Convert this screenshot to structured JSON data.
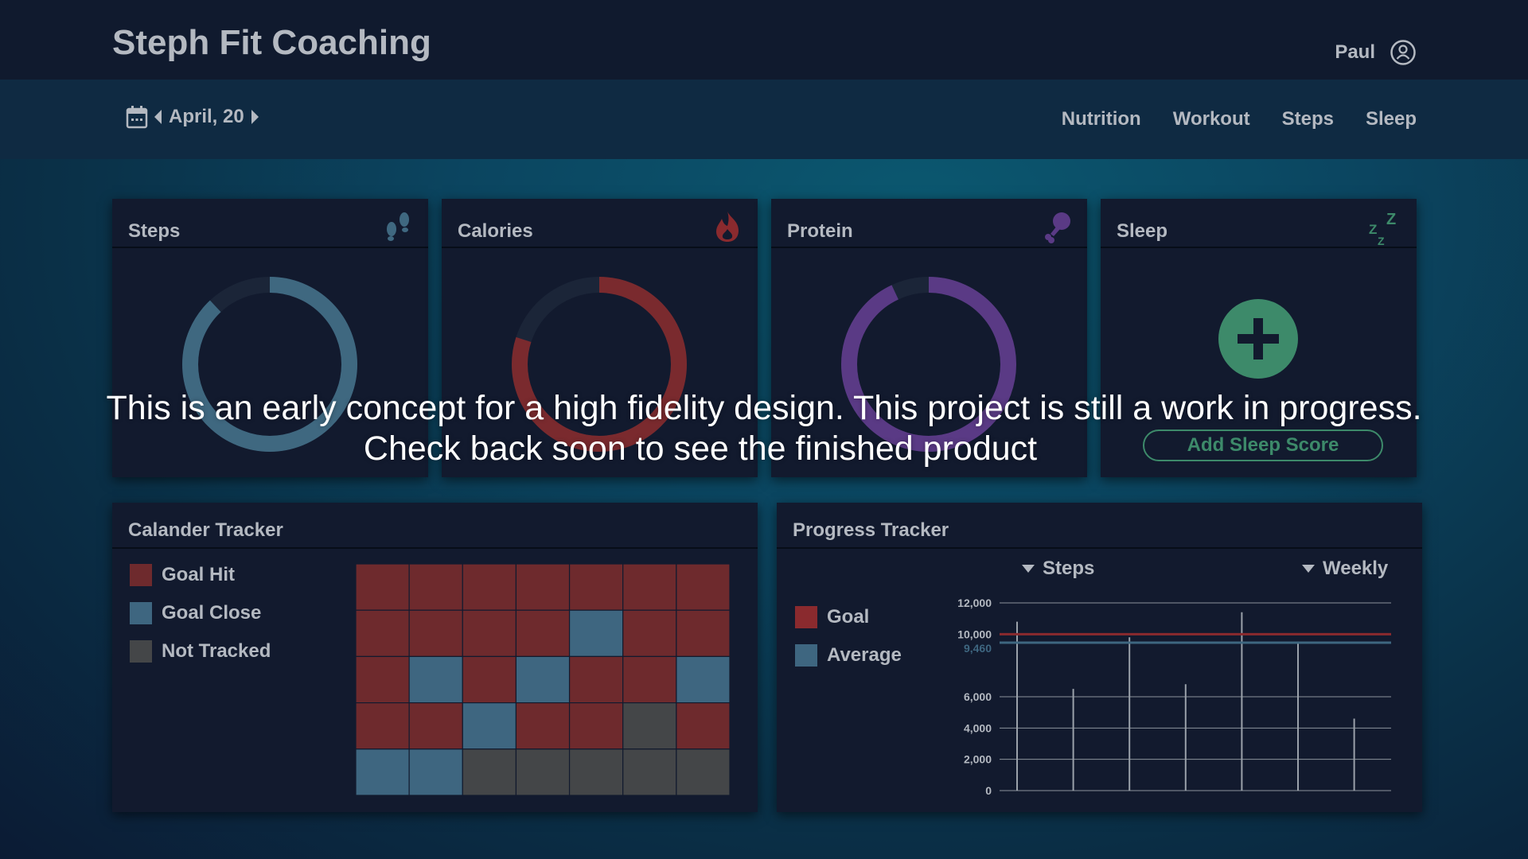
{
  "header": {
    "brand": "Steph Fit Coaching",
    "user_name": "Paul"
  },
  "subnav": {
    "date": "April, 20",
    "links": [
      "Nutrition",
      "Workout",
      "Steps",
      "Sleep"
    ]
  },
  "colors": {
    "steps": "#3f6880",
    "calories": "#7a2a2e",
    "protein": "#5a3a85",
    "sleep": "#3d8a6a",
    "goal_hit": "#6e2a2d",
    "goal_close": "#3e6680",
    "not_tracked": "#444648",
    "goal_line": "#8a2a2e",
    "average_line": "#3e6680"
  },
  "cards": {
    "steps": {
      "title": "Steps",
      "icon": "footprints-icon",
      "progress": 0.88
    },
    "calories": {
      "title": "Calories",
      "icon": "flame-icon",
      "progress": 0.8
    },
    "protein": {
      "title": "Protein",
      "icon": "drumstick-icon",
      "progress": 0.93
    },
    "sleep": {
      "title": "Sleep",
      "icon": "zzz-icon",
      "button": "Add Sleep Score"
    }
  },
  "calendar": {
    "title": "Calander Tracker",
    "legend": [
      "Goal Hit",
      "Goal Close",
      "Not Tracked"
    ],
    "grid": [
      [
        "hit",
        "hit",
        "hit",
        "hit",
        "hit",
        "hit",
        "hit"
      ],
      [
        "hit",
        "hit",
        "hit",
        "hit",
        "close",
        "hit",
        "hit"
      ],
      [
        "hit",
        "close",
        "hit",
        "close",
        "hit",
        "hit",
        "close"
      ],
      [
        "hit",
        "hit",
        "close",
        "hit",
        "hit",
        "none",
        "hit"
      ],
      [
        "close",
        "close",
        "none",
        "none",
        "none",
        "none",
        "none"
      ]
    ]
  },
  "progress": {
    "title": "Progress Tracker",
    "metric": "Steps",
    "period": "Weekly",
    "legend": [
      "Goal",
      "Average"
    ]
  },
  "chart_data": {
    "type": "bar",
    "y_ticks": [
      "0",
      "2,000",
      "4,000",
      "6,000",
      "10,000",
      "12,000"
    ],
    "average_label": "9,460",
    "ylim": [
      0,
      12000
    ],
    "values": [
      10800,
      6500,
      9800,
      6800,
      11400,
      9400,
      4600
    ],
    "goal": 10000,
    "average": 9460,
    "series": [
      {
        "name": "Goal"
      },
      {
        "name": "Average"
      }
    ]
  },
  "overlay": {
    "line1": "This is an early concept for a high fidelity design. This project is still a work in progress.",
    "line2": "Check back soon to see the finished product"
  }
}
